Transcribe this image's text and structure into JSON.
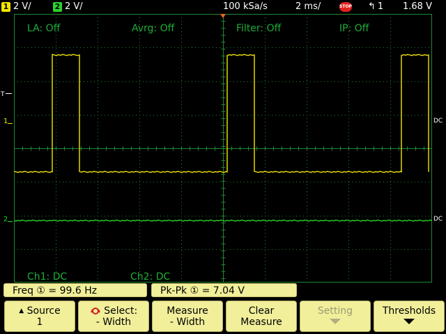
{
  "status": {
    "ch1_badge": "1",
    "ch1_scale": "2 V/",
    "ch2_badge": "2",
    "ch2_scale": "2 V/",
    "sample_rate": "100 kSa/s",
    "timebase": "2 ms/",
    "stop_label": "STOP",
    "trigger_source": "1",
    "trigger_level": "1.68 V"
  },
  "overlays": {
    "la": "LA: Off",
    "avrg": "Avrg: Off",
    "filter": "Filter: Off",
    "ip": "IP: Off",
    "ch1_coupling": "Ch1: DC",
    "ch2_coupling": "Ch2: DC"
  },
  "markers": {
    "trigger_left": "T",
    "ch1_left": "1",
    "ch2_left": "2",
    "ch1_right": "DC",
    "ch2_right": "DC"
  },
  "measurements": {
    "freq": "Freq ① = 99.6  Hz",
    "pkpk": "Pk-Pk ① =  7.04  V"
  },
  "softkeys": {
    "source_label": "Source",
    "source_value": "1",
    "select_label": "Select:",
    "select_value": "- Width",
    "measure_label": "Measure",
    "measure_value": "- Width",
    "clear_label": "Clear",
    "clear_value": "Measure",
    "setting_label": "Setting",
    "thresholds_label": "Thresholds"
  },
  "colors": {
    "ch1": "#f2e600",
    "ch2": "#2ad52a",
    "grid": "#1f8a32",
    "label_green": "#1fae3a",
    "key_bg": "#f1ef9a"
  },
  "chart_data": {
    "type": "line",
    "series": [
      {
        "values_kind": "square-wave",
        "high_fraction": 0.1,
        "periods_on_screen": 2
      }
    ],
    "frequency": "99.6 Hz",
    "pk_pk": "7.04 V",
    "grid": true
  }
}
